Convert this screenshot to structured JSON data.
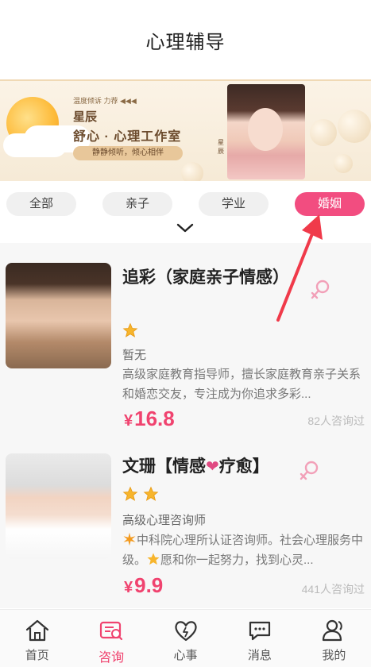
{
  "header": {
    "title": "心理辅导"
  },
  "banner": {
    "small_text": "温度倾诉 力荐 ◀◀◀",
    "title": "星辰",
    "subtitle": "舒心 · 心理工作室",
    "tagline": "静静倾听，倾心相伴",
    "vertical_text": "星辰"
  },
  "tabs": [
    {
      "label": "全部",
      "active": false
    },
    {
      "label": "亲子",
      "active": false
    },
    {
      "label": "学业",
      "active": false
    },
    {
      "label": "婚姻",
      "active": true
    }
  ],
  "counselors": [
    {
      "name": "追彩（家庭亲子情感）",
      "stars": 1,
      "title": "暂无",
      "description": "高级家庭教育指导师，擅长家庭教育亲子关系和婚恋交友，专注成为你追求多彩...",
      "price_currency": "¥",
      "price": "16.8",
      "consult_count": "82人咨询过"
    },
    {
      "name_prefix": "文珊【情感",
      "name_heart": "❤",
      "name_suffix": "疗愈】",
      "stars": 2,
      "title": "高级心理咨询师",
      "description_part1": "中科院心理所认证咨询师。社会心理服务中级。",
      "description_part2": "愿和你一起努力，找到心灵...",
      "price_currency": "¥",
      "price": "9.9",
      "consult_count": "441人咨询过"
    }
  ],
  "nav": [
    {
      "label": "首页",
      "icon": "home-icon",
      "active": false
    },
    {
      "label": "咨询",
      "icon": "consult-icon",
      "active": true
    },
    {
      "label": "心事",
      "icon": "heart-icon",
      "active": false
    },
    {
      "label": "消息",
      "icon": "message-icon",
      "active": false
    },
    {
      "label": "我的",
      "icon": "user-icon",
      "active": false
    }
  ],
  "colors": {
    "accent": "#f0436f",
    "tab_active": "#f24d80",
    "banner_bg": "#f6ead6"
  }
}
